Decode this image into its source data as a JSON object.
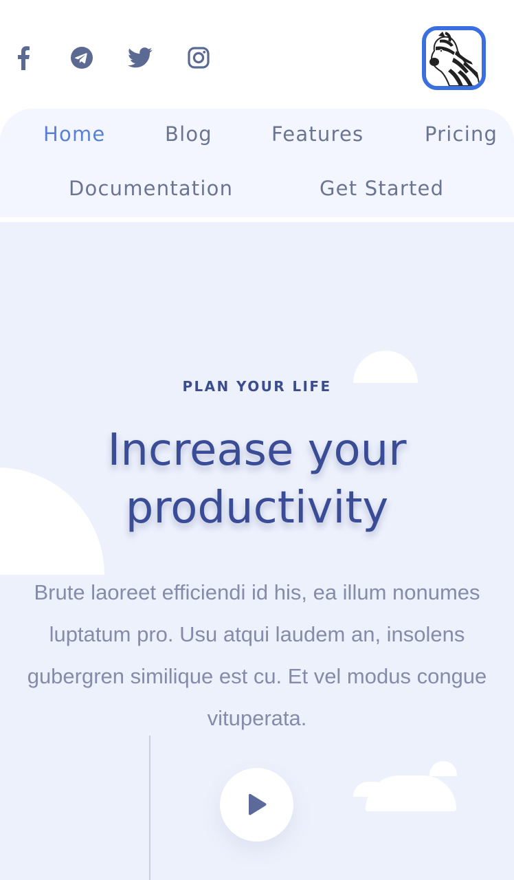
{
  "social": {
    "icons": [
      "facebook-icon",
      "telegram-icon",
      "twitter-icon",
      "instagram-icon"
    ],
    "color": "#5b6a92"
  },
  "logo": {
    "icon": "zebra-icon",
    "border_color": "#3b6fe0"
  },
  "nav": {
    "items": [
      {
        "label": "Home",
        "active": true
      },
      {
        "label": "Blog",
        "active": false
      },
      {
        "label": "Features",
        "active": false
      },
      {
        "label": "Pricing",
        "active": false
      },
      {
        "label": "Documentation",
        "active": false
      },
      {
        "label": "Get Started",
        "active": false
      }
    ],
    "active_color": "#5a7fd6",
    "text_color": "#6b7591"
  },
  "hero": {
    "eyebrow": "PLAN YOUR LIFE",
    "headline_line1": "Increase your",
    "headline_line2": "productivity",
    "paragraph": "Brute laoreet efficiendi id his, ea illum nonumes luptatum pro. Usu atqui laudem an, insolens gubergren similique est cu. Et vel modus congue vituperata.",
    "play_icon": "play-icon",
    "background": "#edf1fc",
    "heading_color": "#3a4c96"
  }
}
